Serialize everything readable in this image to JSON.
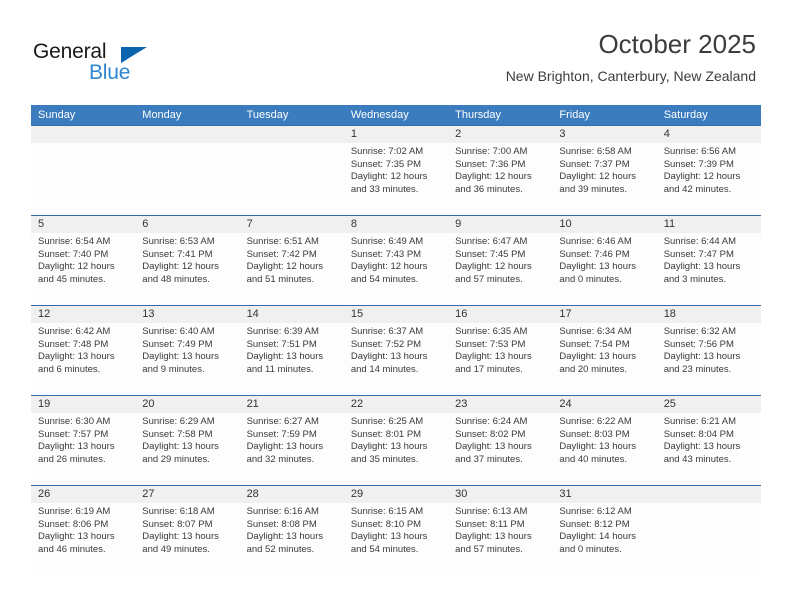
{
  "brand": {
    "name_part1": "General",
    "name_part2": "Blue"
  },
  "header": {
    "title": "October 2025",
    "subtitle": "New Brighton, Canterbury, New Zealand"
  },
  "colors": {
    "header_row_bg": "#3b7cbf",
    "week_divider": "#2f6ea8",
    "daynum_bg": "#f0f0f0",
    "brand_blue": "#2f86d3",
    "brand_triangle": "#0a63ad"
  },
  "weekday_headers": [
    "Sunday",
    "Monday",
    "Tuesday",
    "Wednesday",
    "Thursday",
    "Friday",
    "Saturday"
  ],
  "weeks": [
    [
      {
        "day": "",
        "empty": true
      },
      {
        "day": "",
        "empty": true
      },
      {
        "day": "",
        "empty": true
      },
      {
        "day": "1",
        "sunrise": "Sunrise: 7:02 AM",
        "sunset": "Sunset: 7:35 PM",
        "daylight": "Daylight: 12 hours and 33 minutes."
      },
      {
        "day": "2",
        "sunrise": "Sunrise: 7:00 AM",
        "sunset": "Sunset: 7:36 PM",
        "daylight": "Daylight: 12 hours and 36 minutes."
      },
      {
        "day": "3",
        "sunrise": "Sunrise: 6:58 AM",
        "sunset": "Sunset: 7:37 PM",
        "daylight": "Daylight: 12 hours and 39 minutes."
      },
      {
        "day": "4",
        "sunrise": "Sunrise: 6:56 AM",
        "sunset": "Sunset: 7:39 PM",
        "daylight": "Daylight: 12 hours and 42 minutes."
      }
    ],
    [
      {
        "day": "5",
        "sunrise": "Sunrise: 6:54 AM",
        "sunset": "Sunset: 7:40 PM",
        "daylight": "Daylight: 12 hours and 45 minutes."
      },
      {
        "day": "6",
        "sunrise": "Sunrise: 6:53 AM",
        "sunset": "Sunset: 7:41 PM",
        "daylight": "Daylight: 12 hours and 48 minutes."
      },
      {
        "day": "7",
        "sunrise": "Sunrise: 6:51 AM",
        "sunset": "Sunset: 7:42 PM",
        "daylight": "Daylight: 12 hours and 51 minutes."
      },
      {
        "day": "8",
        "sunrise": "Sunrise: 6:49 AM",
        "sunset": "Sunset: 7:43 PM",
        "daylight": "Daylight: 12 hours and 54 minutes."
      },
      {
        "day": "9",
        "sunrise": "Sunrise: 6:47 AM",
        "sunset": "Sunset: 7:45 PM",
        "daylight": "Daylight: 12 hours and 57 minutes."
      },
      {
        "day": "10",
        "sunrise": "Sunrise: 6:46 AM",
        "sunset": "Sunset: 7:46 PM",
        "daylight": "Daylight: 13 hours and 0 minutes."
      },
      {
        "day": "11",
        "sunrise": "Sunrise: 6:44 AM",
        "sunset": "Sunset: 7:47 PM",
        "daylight": "Daylight: 13 hours and 3 minutes."
      }
    ],
    [
      {
        "day": "12",
        "sunrise": "Sunrise: 6:42 AM",
        "sunset": "Sunset: 7:48 PM",
        "daylight": "Daylight: 13 hours and 6 minutes."
      },
      {
        "day": "13",
        "sunrise": "Sunrise: 6:40 AM",
        "sunset": "Sunset: 7:49 PM",
        "daylight": "Daylight: 13 hours and 9 minutes."
      },
      {
        "day": "14",
        "sunrise": "Sunrise: 6:39 AM",
        "sunset": "Sunset: 7:51 PM",
        "daylight": "Daylight: 13 hours and 11 minutes."
      },
      {
        "day": "15",
        "sunrise": "Sunrise: 6:37 AM",
        "sunset": "Sunset: 7:52 PM",
        "daylight": "Daylight: 13 hours and 14 minutes."
      },
      {
        "day": "16",
        "sunrise": "Sunrise: 6:35 AM",
        "sunset": "Sunset: 7:53 PM",
        "daylight": "Daylight: 13 hours and 17 minutes."
      },
      {
        "day": "17",
        "sunrise": "Sunrise: 6:34 AM",
        "sunset": "Sunset: 7:54 PM",
        "daylight": "Daylight: 13 hours and 20 minutes."
      },
      {
        "day": "18",
        "sunrise": "Sunrise: 6:32 AM",
        "sunset": "Sunset: 7:56 PM",
        "daylight": "Daylight: 13 hours and 23 minutes."
      }
    ],
    [
      {
        "day": "19",
        "sunrise": "Sunrise: 6:30 AM",
        "sunset": "Sunset: 7:57 PM",
        "daylight": "Daylight: 13 hours and 26 minutes."
      },
      {
        "day": "20",
        "sunrise": "Sunrise: 6:29 AM",
        "sunset": "Sunset: 7:58 PM",
        "daylight": "Daylight: 13 hours and 29 minutes."
      },
      {
        "day": "21",
        "sunrise": "Sunrise: 6:27 AM",
        "sunset": "Sunset: 7:59 PM",
        "daylight": "Daylight: 13 hours and 32 minutes."
      },
      {
        "day": "22",
        "sunrise": "Sunrise: 6:25 AM",
        "sunset": "Sunset: 8:01 PM",
        "daylight": "Daylight: 13 hours and 35 minutes."
      },
      {
        "day": "23",
        "sunrise": "Sunrise: 6:24 AM",
        "sunset": "Sunset: 8:02 PM",
        "daylight": "Daylight: 13 hours and 37 minutes."
      },
      {
        "day": "24",
        "sunrise": "Sunrise: 6:22 AM",
        "sunset": "Sunset: 8:03 PM",
        "daylight": "Daylight: 13 hours and 40 minutes."
      },
      {
        "day": "25",
        "sunrise": "Sunrise: 6:21 AM",
        "sunset": "Sunset: 8:04 PM",
        "daylight": "Daylight: 13 hours and 43 minutes."
      }
    ],
    [
      {
        "day": "26",
        "sunrise": "Sunrise: 6:19 AM",
        "sunset": "Sunset: 8:06 PM",
        "daylight": "Daylight: 13 hours and 46 minutes."
      },
      {
        "day": "27",
        "sunrise": "Sunrise: 6:18 AM",
        "sunset": "Sunset: 8:07 PM",
        "daylight": "Daylight: 13 hours and 49 minutes."
      },
      {
        "day": "28",
        "sunrise": "Sunrise: 6:16 AM",
        "sunset": "Sunset: 8:08 PM",
        "daylight": "Daylight: 13 hours and 52 minutes."
      },
      {
        "day": "29",
        "sunrise": "Sunrise: 6:15 AM",
        "sunset": "Sunset: 8:10 PM",
        "daylight": "Daylight: 13 hours and 54 minutes."
      },
      {
        "day": "30",
        "sunrise": "Sunrise: 6:13 AM",
        "sunset": "Sunset: 8:11 PM",
        "daylight": "Daylight: 13 hours and 57 minutes."
      },
      {
        "day": "31",
        "sunrise": "Sunrise: 6:12 AM",
        "sunset": "Sunset: 8:12 PM",
        "daylight": "Daylight: 14 hours and 0 minutes."
      },
      {
        "day": "",
        "empty": true
      }
    ]
  ]
}
